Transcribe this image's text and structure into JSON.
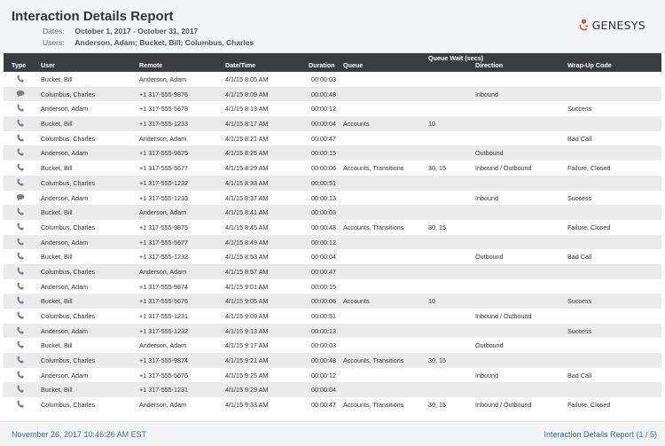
{
  "report": {
    "title": "Interaction Details Report",
    "dates_label": "Dates:",
    "dates_value": "October 1, 2017 - October 31, 2017",
    "users_label": "Users:",
    "users_value": "Anderson, Adam; Bucket, Bill; Columbus, Charles",
    "logo_text": "GENESYS",
    "brand_color": "#e0533a"
  },
  "table": {
    "headers": {
      "type": "Type",
      "user": "User",
      "remote": "Remote",
      "datetime": "Date/Time",
      "duration": "Duration",
      "queue": "Queue",
      "queue_wait": "Queue Wait (secs)",
      "direction": "Direction",
      "wrapup": "Wrap-Up Code"
    },
    "rows": [
      {
        "type": "phone-icon",
        "user": "Bucket, Bill",
        "remote": "Anderson, Adam",
        "datetime": "4/1/15 8:05 AM",
        "duration": "00:00:03",
        "queue": "",
        "queue_wait": "",
        "direction": "",
        "wrapup": ""
      },
      {
        "type": "chat-icon",
        "user": "Columbus, Charles",
        "remote": "+1 317-555-9876",
        "datetime": "4/1/15 8:09 AM",
        "duration": "00:00:48",
        "queue": "",
        "queue_wait": "",
        "direction": "Inbound",
        "wrapup": ""
      },
      {
        "type": "phone-icon",
        "user": "Anderson, Adam",
        "remote": "+1 317-555-5678",
        "datetime": "4/1/15 8:13 AM",
        "duration": "00:00:12",
        "queue": "",
        "queue_wait": "",
        "direction": "",
        "wrapup": "Success"
      },
      {
        "type": "phone-icon",
        "user": "Bucket, Bill",
        "remote": "+1 317-555-1233",
        "datetime": "4/1/15 8:17 AM",
        "duration": "00:00:04",
        "queue": "Accounts",
        "queue_wait": "10",
        "direction": "",
        "wrapup": ""
      },
      {
        "type": "phone-icon",
        "user": "Columbus, Charles",
        "remote": "Anderson, Adam",
        "datetime": "4/1/15 8:21 AM",
        "duration": "00:00:47",
        "queue": "",
        "queue_wait": "",
        "direction": "",
        "wrapup": "Bad Call"
      },
      {
        "type": "phone-icon",
        "user": "Anderson, Adam",
        "remote": "+1 317-555-9875",
        "datetime": "4/1/15 8:25 AM",
        "duration": "00:00:15",
        "queue": "",
        "queue_wait": "",
        "direction": "Outbound",
        "wrapup": ""
      },
      {
        "type": "phone-icon",
        "user": "Bucket, Bill",
        "remote": "+1 317-555-5677",
        "datetime": "4/1/15 8:29 AM",
        "duration": "00:00:06",
        "queue": "Accounts, Transitions",
        "queue_wait": "30, 15",
        "direction": "Inbound / Outbound",
        "wrapup": "Failure, Closed"
      },
      {
        "type": "phone-icon",
        "user": "Columbus, Charles",
        "remote": "+1 317-555-1232",
        "datetime": "4/1/15 8:33 AM",
        "duration": "00:00:51",
        "queue": "",
        "queue_wait": "",
        "direction": "",
        "wrapup": ""
      },
      {
        "type": "chat-icon",
        "user": "Anderson, Adam",
        "remote": "+1 317-555-1233",
        "datetime": "4/1/15 8:37 AM",
        "duration": "00:00:13",
        "queue": "",
        "queue_wait": "",
        "direction": "Inbound",
        "wrapup": "Success"
      },
      {
        "type": "phone-icon",
        "user": "Bucket, Bill",
        "remote": "Anderson, Adam",
        "datetime": "4/1/15 8:41 AM",
        "duration": "00:00:03",
        "queue": "",
        "queue_wait": "",
        "direction": "",
        "wrapup": ""
      },
      {
        "type": "phone-icon",
        "user": "Columbus, Charles",
        "remote": "+1 317-555-9875",
        "datetime": "4/1/15 8:45 AM",
        "duration": "00:00:48",
        "queue": "Accounts, Transitions",
        "queue_wait": "30, 15",
        "direction": "",
        "wrapup": "Failure, Closed"
      },
      {
        "type": "phone-icon",
        "user": "Anderson, Adam",
        "remote": "+1 317-555-5677",
        "datetime": "4/1/15 8:49 AM",
        "duration": "00:00:12",
        "queue": "",
        "queue_wait": "",
        "direction": "",
        "wrapup": ""
      },
      {
        "type": "phone-icon",
        "user": "Bucket, Bill",
        "remote": "+1 317-555-1232",
        "datetime": "4/1/15 8:53 AM",
        "duration": "00:00:04",
        "queue": "",
        "queue_wait": "",
        "direction": "Outbound",
        "wrapup": "Bad Call"
      },
      {
        "type": "phone-icon",
        "user": "Columbus, Charles",
        "remote": "Anderson, Adam",
        "datetime": "4/1/15 8:57 AM",
        "duration": "00:00:47",
        "queue": "",
        "queue_wait": "",
        "direction": "",
        "wrapup": ""
      },
      {
        "type": "phone-icon",
        "user": "Anderson, Adam",
        "remote": "+1 317-555-9874",
        "datetime": "4/1/15 9:01 AM",
        "duration": "00:00:15",
        "queue": "",
        "queue_wait": "",
        "direction": "",
        "wrapup": ""
      },
      {
        "type": "phone-icon",
        "user": "Bucket, Bill",
        "remote": "+1 317-555-5676",
        "datetime": "4/1/15 9:05 AM",
        "duration": "00:00:06",
        "queue": "Accounts",
        "queue_wait": "10",
        "direction": "",
        "wrapup": "Success"
      },
      {
        "type": "phone-icon",
        "user": "Columbus, Charles",
        "remote": "+1 317-555-1231",
        "datetime": "4/1/15 9:09 AM",
        "duration": "00:00:51",
        "queue": "",
        "queue_wait": "",
        "direction": "Inbound / Outbound",
        "wrapup": ""
      },
      {
        "type": "phone-icon",
        "user": "Anderson, Adam",
        "remote": "+1 317-555-1232",
        "datetime": "4/1/15 9:13 AM",
        "duration": "00:00:13",
        "queue": "",
        "queue_wait": "",
        "direction": "",
        "wrapup": "Success"
      },
      {
        "type": "phone-icon",
        "user": "Bucket, Bill",
        "remote": "Anderson, Adam",
        "datetime": "4/1/15 9:17 AM",
        "duration": "00:00:03",
        "queue": "",
        "queue_wait": "",
        "direction": "Outbound",
        "wrapup": ""
      },
      {
        "type": "phone-icon",
        "user": "Columbus, Charles",
        "remote": "+1 317-555-9874",
        "datetime": "4/1/15 9:21 AM",
        "duration": "00:00:48",
        "queue": "Accounts, Transitions",
        "queue_wait": "30, 15",
        "direction": "",
        "wrapup": ""
      },
      {
        "type": "phone-icon",
        "user": "Anderson, Adam",
        "remote": "+1 317-555-5676",
        "datetime": "4/1/15 9:25 AM",
        "duration": "00:00:12",
        "queue": "",
        "queue_wait": "",
        "direction": "Inbound",
        "wrapup": "Bad Call"
      },
      {
        "type": "phone-icon",
        "user": "Bucket, Bill",
        "remote": "+1 317-555-1231",
        "datetime": "4/1/15 9:29 AM",
        "duration": "00:00:04",
        "queue": "",
        "queue_wait": "",
        "direction": "",
        "wrapup": ""
      },
      {
        "type": "phone-icon",
        "user": "Columbus, Charles",
        "remote": "Anderson, Adam",
        "datetime": "4/1/15 9:33 AM",
        "duration": "00:00:47",
        "queue": "Accounts, Transitions",
        "queue_wait": "30, 15",
        "direction": "Inbound / Outbound",
        "wrapup": "Failure, Closed"
      }
    ]
  },
  "footer": {
    "timestamp": "November 26, 2017 10:46:26 AM EST",
    "page_info": "Interaction Details Report (1 / 5)",
    "link_color": "#3a6ea5"
  }
}
